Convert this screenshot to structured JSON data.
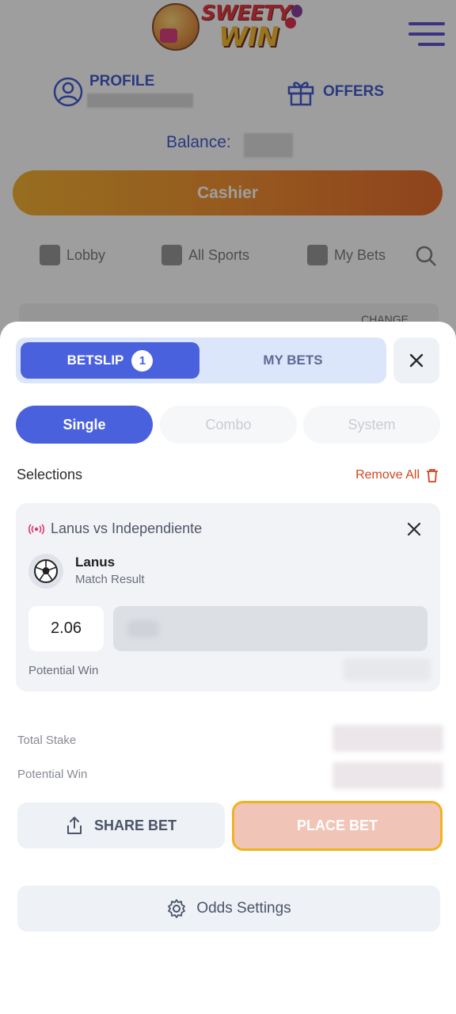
{
  "header": {
    "logo_text_line1": "SWEETY",
    "logo_text_line2": "WIN",
    "profile_label": "PROFILE",
    "offers_label": "OFFERS",
    "balance_label": "Balance:",
    "cashier_label": "Cashier"
  },
  "subnav": {
    "items": [
      "Lobby",
      "All Sports",
      "My Bets"
    ],
    "change_label": "CHANGE"
  },
  "betslip": {
    "tab_active_label": "BETSLIP",
    "tab_badge": "1",
    "tab_inactive_label": "MY BETS",
    "bet_types": [
      "Single",
      "Combo",
      "System"
    ],
    "selections_label": "Selections",
    "remove_all_label": "Remove All",
    "selection": {
      "event": "Lanus vs Independiente",
      "team": "Lanus",
      "market": "Match Result",
      "odds": "2.06",
      "potential_win_label": "Potential Win"
    },
    "total_stake_label": "Total Stake",
    "potential_win_label": "Potential Win",
    "share_bet_label": "SHARE BET",
    "place_bet_label": "PLACE BET",
    "odds_settings_label": "Odds Settings"
  },
  "colors": {
    "primary": "#4a61de",
    "brand_blue": "#2c47c9",
    "cashier_orange": "#ef7c18",
    "danger": "#d04620",
    "place_bet_border": "#f2b21f"
  }
}
